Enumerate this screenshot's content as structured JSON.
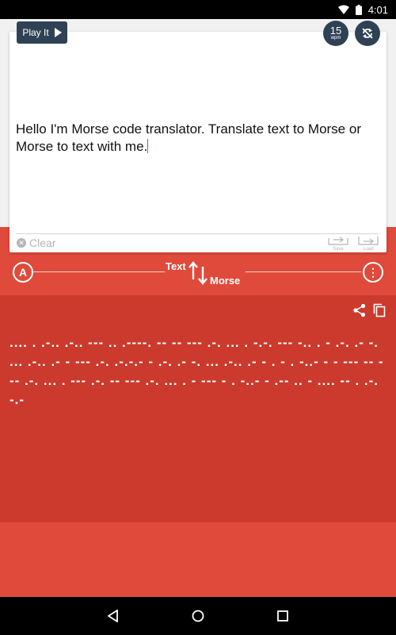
{
  "status_bar": {
    "time": "4:01"
  },
  "toolbar": {
    "play_label": "Play It",
    "wpm_value": "15",
    "wpm_unit": "wpm"
  },
  "input": {
    "text": "Hello I'm Morse code translator. Translate text to Morse or Morse to text with me.",
    "clear_label": "Clear",
    "save_label": "Save",
    "load_label": "Load"
  },
  "switcher": {
    "from_label": "Text",
    "to_label": "Morse",
    "alpha_label": "A",
    "menu_label": "⋮"
  },
  "output": {
    "morse": ".... . .-.. .-.. --- .. .----. -- -- --- .-. ... . -.-. --- -.. . - .-. .- -. ... .-.. .- - --- .-. .-.-.- - .-. .- -. ... .-.. .- - . - . -..- - - --- -- --- .-. ... . --- .-. -- --- .-. ... . - --- - . -..- - .-- .. - .... -- . .-.-.-"
  },
  "colors": {
    "accent": "#e04a3b",
    "output_bg": "#cb3a2d",
    "button_dark": "#2f4255"
  }
}
